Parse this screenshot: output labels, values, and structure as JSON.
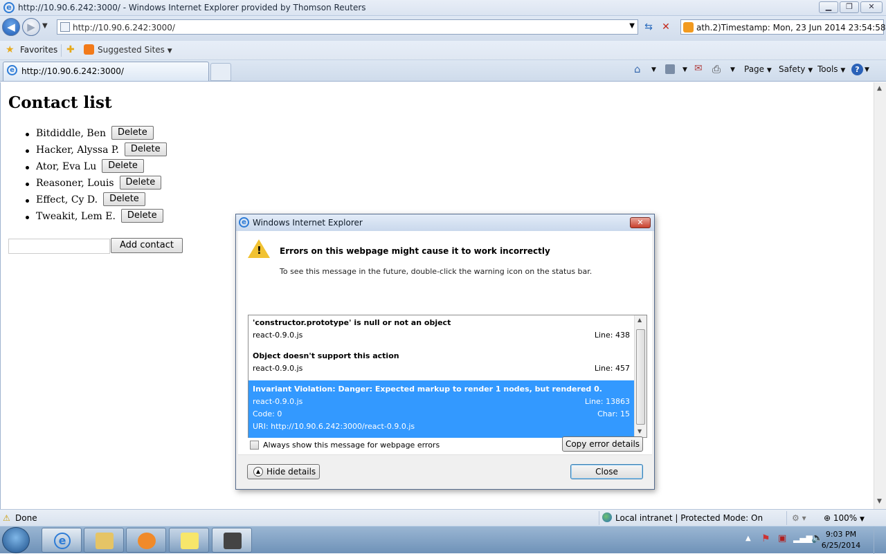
{
  "window": {
    "title": "http://10.90.6.242:3000/ - Windows Internet Explorer provided by Thomson Reuters",
    "minimize_icon": "minimize-icon",
    "maximize_icon": "maximize-icon",
    "close_icon": "close-icon"
  },
  "address_bar": {
    "url": "http://10.90.6.242:3000/",
    "search_text": "ath.2)Timestamp: Mon, 23 Jun 2014 23:54:58"
  },
  "favorites_bar": {
    "favorites_label": "Favorites",
    "suggested_sites_label": "Suggested Sites"
  },
  "tabs": [
    {
      "label": "http://10.90.6.242:3000/"
    }
  ],
  "command_bar": {
    "page_label": "Page",
    "safety_label": "Safety",
    "tools_label": "Tools"
  },
  "page": {
    "title": "Contact list",
    "contacts": [
      {
        "name": "Bitdiddle, Ben",
        "delete_label": "Delete"
      },
      {
        "name": "Hacker, Alyssa P.",
        "delete_label": "Delete"
      },
      {
        "name": "Ator, Eva Lu",
        "delete_label": "Delete"
      },
      {
        "name": "Reasoner, Louis",
        "delete_label": "Delete"
      },
      {
        "name": "Effect, Cy D.",
        "delete_label": "Delete"
      },
      {
        "name": "Tweakit, Lem E.",
        "delete_label": "Delete"
      }
    ],
    "new_contact_value": "",
    "add_contact_label": "Add contact"
  },
  "dialog": {
    "title": "Windows Internet Explorer",
    "heading": "Errors on this webpage might cause it to work incorrectly",
    "subtext": "To see this message in the future, double-click the warning icon on the status bar.",
    "errors": [
      {
        "message": "'constructor.prototype' is null or not an object",
        "file": "react-0.9.0.js",
        "line": "Line: 438"
      },
      {
        "message": "Object doesn't support this action",
        "file": "react-0.9.0.js",
        "line": "Line: 457"
      },
      {
        "message": "Invariant Violation: Danger: Expected markup to render 1 nodes, but rendered 0.",
        "file": "react-0.9.0.js",
        "line": "Line: 13863",
        "code": "Code: 0",
        "char": "Char: 15",
        "uri": "URI: http://10.90.6.242:3000/react-0.9.0.js",
        "selected": true
      }
    ],
    "always_show_label": "Always show this message for webpage errors",
    "copy_button_label": "Copy error details",
    "hide_details_label": "Hide details",
    "close_button_label": "Close"
  },
  "status_bar": {
    "status": "Done",
    "zone": "Local intranet | Protected Mode: On",
    "zoom": "100%"
  },
  "taskbar": {
    "time": "9:03 PM",
    "date": "6/25/2014"
  },
  "colors": {
    "selection": "#3399ff",
    "warning": "#f1c232"
  }
}
